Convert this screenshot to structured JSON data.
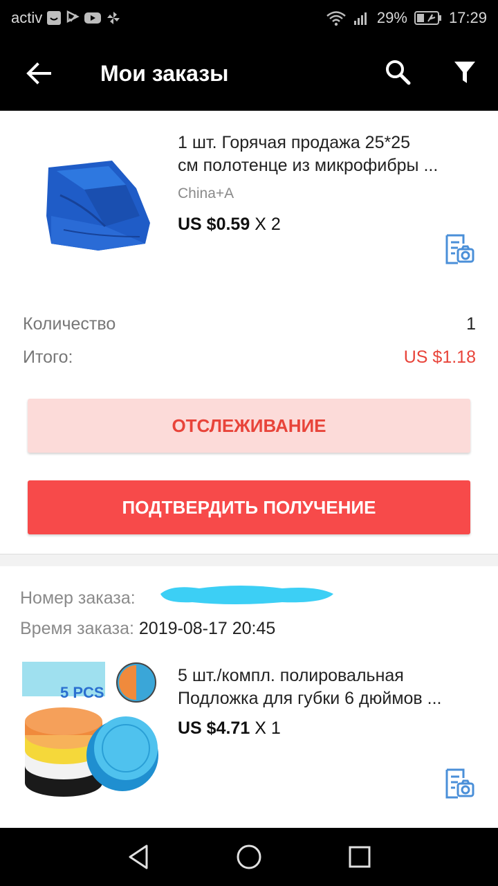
{
  "status_bar": {
    "carrier": "activ",
    "battery": "29%",
    "time": "17:29"
  },
  "app_bar": {
    "title": "Мои заказы"
  },
  "orders": [
    {
      "product": {
        "title_line1": "1 шт. Горячая продажа 25*25",
        "title_line2": "см полотенце из микрофибры ...",
        "store": "China+A",
        "price": "US $0.59",
        "qty": "X 2",
        "image": "blue-microfiber-towel"
      },
      "quantity_label": "Количество",
      "quantity_value": "1",
      "total_label": "Итого:",
      "total_value": "US $1.18",
      "track_button": "ОТСЛЕЖИВАНИЕ",
      "confirm_button": "ПОДТВЕРДИТЬ ПОЛУЧЕНИЕ"
    },
    {
      "order_number_label": "Номер заказа:",
      "order_time_label": "Время заказа:",
      "order_time_value": "2019-08-17 20:45",
      "product": {
        "title_line1": "5 шт./компл. полировальная",
        "title_line2": "Подложка для губки 6 дюймов ...",
        "price": "US $4.71",
        "qty": "X 1",
        "image": "polishing-sponge-pads",
        "image_text": "5 PCS"
      }
    }
  ],
  "colors": {
    "accent_red": "#e8443a",
    "confirm_bg": "#f74a4a",
    "track_bg": "#fcdbd9",
    "icon_blue": "#4a8fd8",
    "redaction": "#3ccff5"
  }
}
